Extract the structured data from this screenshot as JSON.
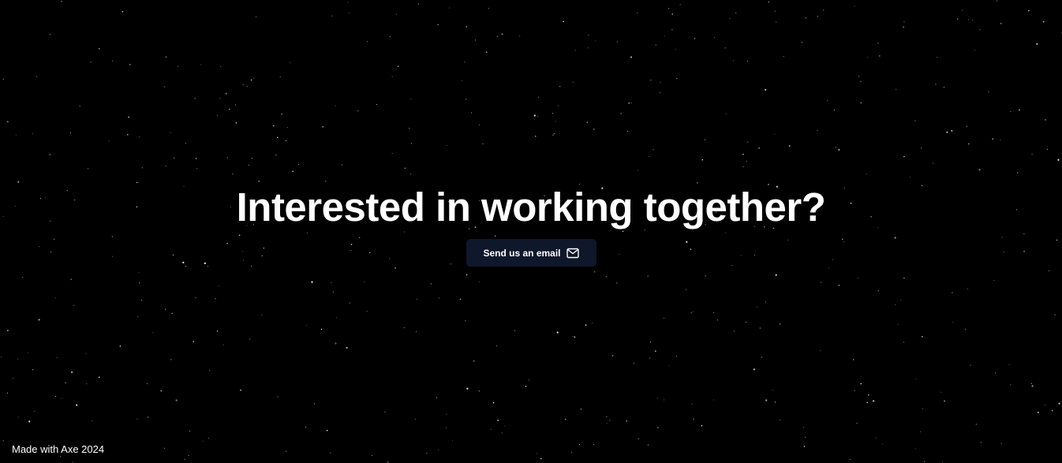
{
  "page": {
    "background_color": "#000000",
    "star_color": "#ffffff"
  },
  "hero": {
    "headline": "Interested in working together?",
    "email_button": {
      "label": "Send us an email",
      "icon": "mail-icon",
      "background_color": "#0f172a"
    }
  },
  "footer": {
    "text": "Made with Axe 2024"
  }
}
